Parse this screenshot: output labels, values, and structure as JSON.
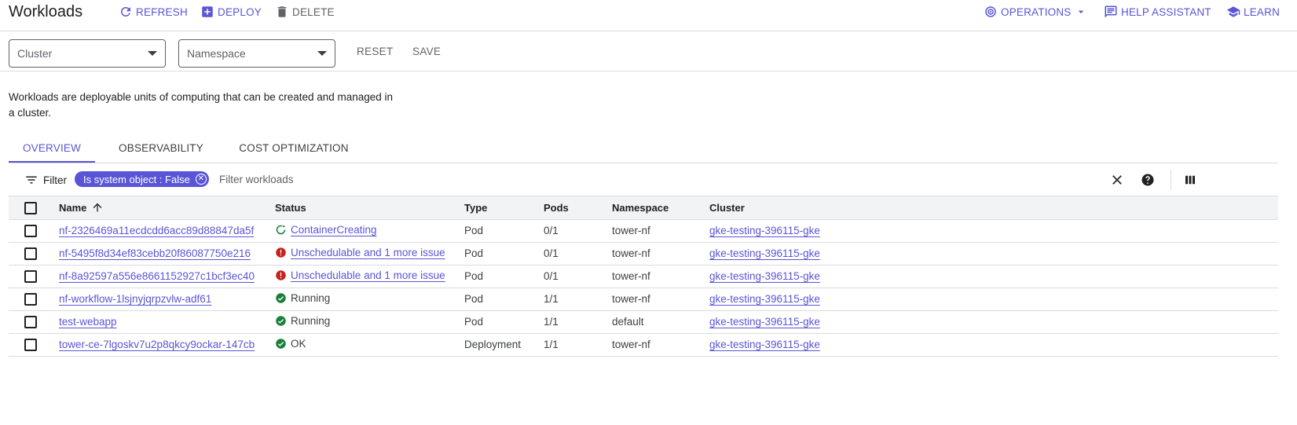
{
  "header": {
    "title": "Workloads",
    "refresh_label": "REFRESH",
    "deploy_label": "DEPLOY",
    "delete_label": "DELETE",
    "operations_label": "OPERATIONS",
    "help_label": "HELP ASSISTANT",
    "learn_label": "LEARN"
  },
  "filters": {
    "cluster_label": "Cluster",
    "namespace_label": "Namespace",
    "reset_label": "RESET",
    "save_label": "SAVE"
  },
  "description": "Workloads are deployable units of computing that can be created and managed in a cluster.",
  "tabs": [
    {
      "label": "OVERVIEW",
      "active": true
    },
    {
      "label": "OBSERVABILITY",
      "active": false
    },
    {
      "label": "COST OPTIMIZATION",
      "active": false
    }
  ],
  "table_filter": {
    "filter_label": "Filter",
    "chip_label": "Is system object : False",
    "placeholder": "Filter workloads"
  },
  "table": {
    "columns": [
      "Name",
      "Status",
      "Type",
      "Pods",
      "Namespace",
      "Cluster"
    ],
    "rows": [
      {
        "name": "nf-2326469a11ecdcdd6acc89d88847da5f",
        "status": "ContainerCreating",
        "status_icon": "sync-icon",
        "type": "Pod",
        "pods": "0/1",
        "namespace": "tower-nf",
        "cluster": "gke-testing-396115-gke"
      },
      {
        "name": "nf-5495f8d34ef83cebb20f86087750e216",
        "status": "Unschedulable and 1 more issue",
        "status_icon": "error-icon",
        "type": "Pod",
        "pods": "0/1",
        "namespace": "tower-nf",
        "cluster": "gke-testing-396115-gke"
      },
      {
        "name": "nf-8a92597a556e8661152927c1bcf3ec40",
        "status": "Unschedulable and 1 more issue",
        "status_icon": "error-icon",
        "type": "Pod",
        "pods": "0/1",
        "namespace": "tower-nf",
        "cluster": "gke-testing-396115-gke"
      },
      {
        "name": "nf-workflow-1lsjnyjqrpzvlw-adf61",
        "status": "Running",
        "status_icon": "check-icon",
        "type": "Pod",
        "pods": "1/1",
        "namespace": "tower-nf",
        "cluster": "gke-testing-396115-gke"
      },
      {
        "name": "test-webapp",
        "status": "Running",
        "status_icon": "check-icon",
        "type": "Pod",
        "pods": "1/1",
        "namespace": "default",
        "cluster": "gke-testing-396115-gke"
      },
      {
        "name": "tower-ce-7lgoskv7u2p8qkcy9ockar-147cb",
        "status": "OK",
        "status_icon": "check-icon",
        "type": "Deployment",
        "pods": "1/1",
        "namespace": "tower-nf",
        "cluster": "gke-testing-396115-gke"
      }
    ]
  },
  "colors": {
    "accent": "#5a55d6",
    "ok": "#188038",
    "error": "#c5221f",
    "header_bg": "#f1f3f4"
  }
}
